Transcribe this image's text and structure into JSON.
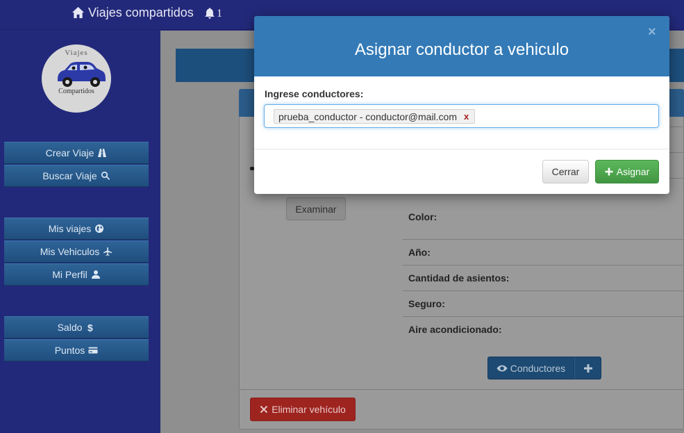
{
  "navbar": {
    "brand": "Viajes compartidos",
    "notifications_count": "1"
  },
  "logo": {
    "top_text": "Viajes",
    "bottom_text": "Compartidos"
  },
  "sidebar": {
    "items": [
      {
        "label": "Crear Viaje",
        "icon": "road-icon"
      },
      {
        "label": "Buscar Viaje",
        "icon": "search-icon"
      },
      {
        "label": "Mis viajes",
        "icon": "globe-icon"
      },
      {
        "label": "Mis Vehiculos",
        "icon": "plane-icon"
      },
      {
        "label": "Mi Perfil",
        "icon": "user-icon"
      },
      {
        "label": "Saldo",
        "icon": "dollar-icon"
      },
      {
        "label": "Puntos",
        "icon": "credit-card-icon"
      }
    ]
  },
  "vehicle": {
    "examinar_label": "Examinar",
    "fields": [
      "Color:",
      "Año:",
      "Cantidad de asientos:",
      "Seguro:",
      "Aire acondicionado:"
    ],
    "conductores_label": "Conductores",
    "delete_label": "Eliminar vehículo"
  },
  "modal": {
    "title": "Asignar conductor a vehiculo",
    "close_symbol": "×",
    "input_label": "Ingrese conductores:",
    "tags": [
      "prueba_conductor - conductor@mail.com"
    ],
    "tag_remove_symbol": "x",
    "cancel_label": "Cerrar",
    "submit_label": "Asignar"
  },
  "colors": {
    "navbar": "#23297a",
    "modal_header": "#337ab7",
    "success": "#5cb85c",
    "danger": "#9e2420"
  }
}
